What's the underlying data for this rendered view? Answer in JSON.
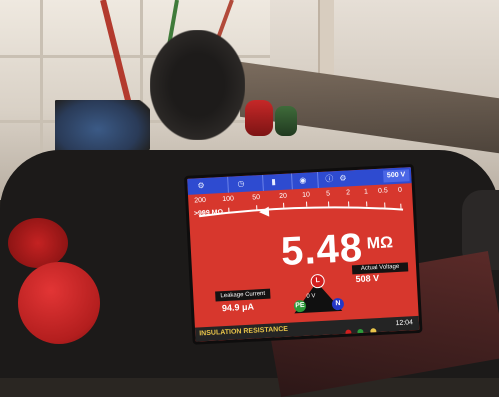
{
  "screen": {
    "range_badge": "500 V",
    "scale_ticks": [
      "200",
      "100",
      "50",
      "20",
      "10",
      "5",
      "2",
      "1",
      "0.5",
      "0"
    ],
    "infinity_label": ">999 MΩ",
    "reading_value": "5.48",
    "reading_unit": "MΩ",
    "actual_voltage_label": "Actual Voltage",
    "actual_voltage_value": "508 V",
    "leakage_current_label": "Leakage Current",
    "leakage_current_value": "94.9 μA",
    "zero_volt_label": "0 V",
    "node_labels": {
      "live": "L",
      "earth": "PE",
      "neutral": "N"
    },
    "mode_title": "INSULATION RESISTANCE",
    "clock": "12:04",
    "top_icons": [
      "bluetooth-icon",
      "clock-icon",
      "battery-icon",
      "settings-icon",
      "info-icon",
      "target-icon"
    ]
  },
  "colors": {
    "screen_bg": "#d7372d",
    "topbar": "#2e4bd0",
    "title_text": "#e9c54a"
  }
}
